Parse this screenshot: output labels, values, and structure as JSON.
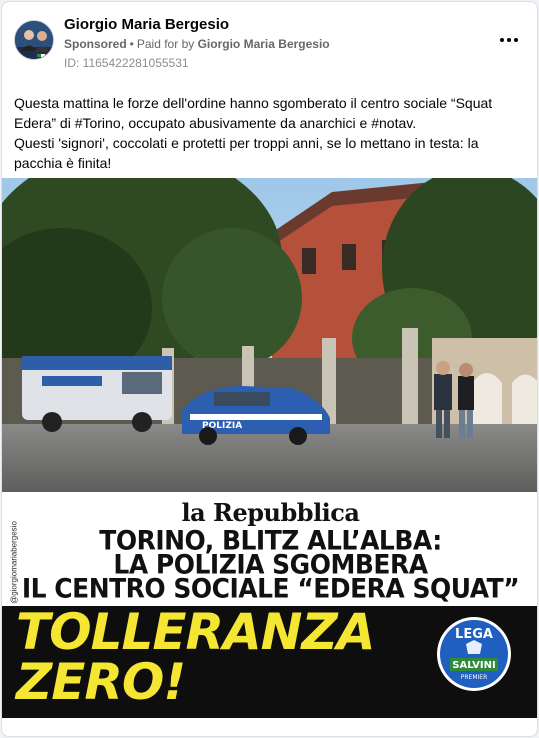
{
  "post": {
    "author": "Giorgio Maria Bergesio",
    "sponsored": "Sponsored",
    "paid_for_by_prefix": "Paid for by",
    "payer": "Giorgio Maria Bergesio",
    "ad_id": "ID: 1165422281055531",
    "body_lines": [
      "Questa mattina le forze dell'ordine hanno sgomberato il centro sociale “Squat Edera” di #Torino, occupato abusivamente da anarchici e #notav.",
      "Questi 'signori', coccolati e protetti per troppi anni, se lo mettano in testa: la pacchia è finita!"
    ]
  },
  "ad_image": {
    "van_text": "POLIZIA",
    "paper_name": "la Repubblica",
    "headline": [
      "TORINO, BLITZ ALL’ALBA:",
      "LA POLIZIA SGOMBERA",
      "IL CENTRO SOCIALE “EDERA SQUAT”"
    ],
    "watermark": "@giorgiomariabergesio",
    "slogan": [
      "TOLLERANZA",
      "ZERO!"
    ],
    "logo": {
      "top": "LEGA",
      "middle": "SALVINI",
      "bottom": "PREMIER"
    }
  },
  "colors": {
    "slogan_yellow": "#f5e633",
    "band_black": "#0e0e0e",
    "logo_blue": "#1f5fbf",
    "logo_green": "#2e8b3a"
  },
  "icons": {
    "more": "more-horizontal-icon",
    "avatar": "profile-avatar-icon"
  }
}
